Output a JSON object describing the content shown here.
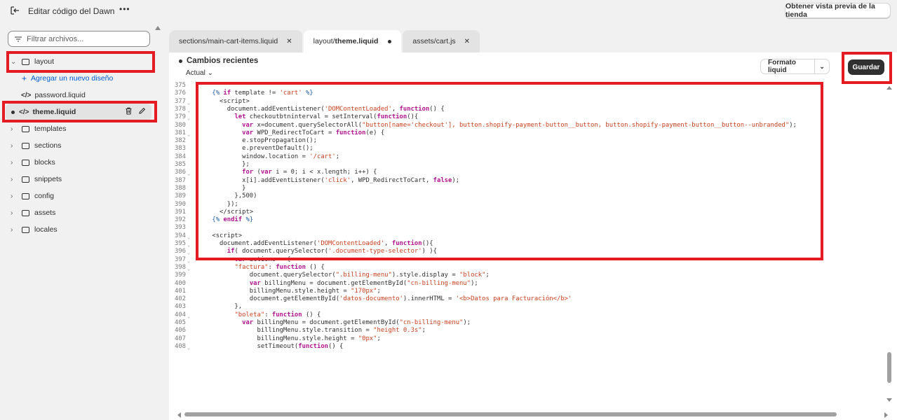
{
  "header": {
    "title": "Editar código del Dawn",
    "more": "•••",
    "preview_label": "Obtener vista previa de la tienda"
  },
  "sidebar": {
    "filter_placeholder": "Filtrar archivos...",
    "items": [
      {
        "type": "folder",
        "label": "layout",
        "expanded": true
      },
      {
        "type": "add",
        "label": "Agregar un nuevo diseño"
      },
      {
        "type": "file",
        "label": "password.liquid"
      },
      {
        "type": "file",
        "label": "theme.liquid",
        "active": true
      },
      {
        "type": "folder",
        "label": "templates"
      },
      {
        "type": "folder",
        "label": "sections"
      },
      {
        "type": "folder",
        "label": "blocks"
      },
      {
        "type": "folder",
        "label": "snippets"
      },
      {
        "type": "folder",
        "label": "config"
      },
      {
        "type": "folder",
        "label": "assets"
      },
      {
        "type": "folder",
        "label": "locales"
      }
    ]
  },
  "tabs": [
    {
      "prefix": "sections/",
      "name": "main-cart-items.liquid",
      "active": false
    },
    {
      "prefix": "layout/",
      "name": "theme.liquid",
      "active": true
    },
    {
      "prefix": "assets/",
      "name": "cart.js",
      "active": false
    }
  ],
  "toolbar": {
    "recent_label": "Cambios recientes",
    "version_label": "Actual",
    "format_label": "Formato liquid",
    "save_label": "Guardar"
  },
  "colors": {
    "highlight": "#e41b23",
    "link": "#005bd3",
    "keyword": "#b2128f",
    "string": "#c93f1e"
  },
  "code_lines": [
    {
      "n": "375",
      "fold": false,
      "html": ""
    },
    {
      "n": "376",
      "fold": false,
      "html": "    <span class=\"fn\">{%</span> <span class=\"kw\">if</span> template != <span class=\"str\">'cart'</span> <span class=\"fn\">%}</span>"
    },
    {
      "n": "377",
      "fold": true,
      "html": "      &lt;script&gt;"
    },
    {
      "n": "378",
      "fold": true,
      "html": "        document.addEventListener(<span class=\"str\">'DOMContentLoaded'</span>, <span class=\"kw\">function</span>() {"
    },
    {
      "n": "379",
      "fold": true,
      "html": "          <span class=\"kw\">let</span> checkoutbtninterval = setInterval(<span class=\"kw\">function</span>(){"
    },
    {
      "n": "380",
      "fold": false,
      "html": "            <span class=\"kw\">var</span> x=document.querySelectorAll(<span class=\"str\">\"button[name='checkout'], button.shopify-payment-button__button, button.shopify-payment-button__button--unbranded\"</span>);"
    },
    {
      "n": "381",
      "fold": true,
      "html": "            <span class=\"kw\">var</span> WPD_RedirectToCart = <span class=\"kw\">function</span>(e) {"
    },
    {
      "n": "382",
      "fold": false,
      "html": "            e.stopPropagation();"
    },
    {
      "n": "383",
      "fold": false,
      "html": "            e.preventDefault();"
    },
    {
      "n": "384",
      "fold": false,
      "html": "            window.location = <span class=\"str\">'/cart'</span>;"
    },
    {
      "n": "385",
      "fold": false,
      "html": "            };"
    },
    {
      "n": "386",
      "fold": true,
      "html": "            <span class=\"kw\">for</span> (<span class=\"kw\">var</span> i = 0; i &lt; x.length; i++) {"
    },
    {
      "n": "387",
      "fold": false,
      "html": "            x[i].addEventListener(<span class=\"str\">'click'</span>, WPD_RedirectToCart, <span class=\"kw\">false</span>);"
    },
    {
      "n": "388",
      "fold": false,
      "html": "            }"
    },
    {
      "n": "389",
      "fold": false,
      "html": "          },500)"
    },
    {
      "n": "390",
      "fold": false,
      "html": "        });"
    },
    {
      "n": "391",
      "fold": false,
      "html": "      &lt;/script&gt;"
    },
    {
      "n": "392",
      "fold": false,
      "html": "    <span class=\"fn\">{%</span> <span class=\"kw\">endif</span> <span class=\"fn\">%}</span>"
    },
    {
      "n": "393",
      "fold": false,
      "html": ""
    },
    {
      "n": "394",
      "fold": true,
      "html": "    &lt;script&gt;"
    },
    {
      "n": "395",
      "fold": true,
      "html": "      document.addEventListener(<span class=\"str\">'DOMContentLoaded'</span>, <span class=\"kw\">function</span>(){"
    },
    {
      "n": "396",
      "fold": true,
      "html": "        <span class=\"kw\">if</span>( document.querySelector(<span class=\"str\">'.document-type-selector'</span>) ){"
    },
    {
      "n": "397",
      "fold": true,
      "html": "          <span class=\"kw\">var</span> actions = {"
    },
    {
      "n": "398",
      "fold": true,
      "html": "          <span class=\"str\">\"factura\"</span>: <span class=\"kw\">function</span> () {"
    },
    {
      "n": "399",
      "fold": false,
      "html": "              document.querySelector(<span class=\"str\">\".billing-menu\"</span>).style.display = <span class=\"str\">\"block\"</span>;"
    },
    {
      "n": "400",
      "fold": false,
      "html": "              <span class=\"kw\">var</span> billingMenu = document.getElementById(<span class=\"str\">\"cn-billing-menu\"</span>);"
    },
    {
      "n": "401",
      "fold": false,
      "html": "              billingMenu.style.height = <span class=\"str\">\"170px\"</span>;"
    },
    {
      "n": "402",
      "fold": false,
      "html": "              document.getElementById(<span class=\"str\">'datos-documento'</span>).innerHTML = <span class=\"str\">'&lt;b&gt;Datos para Facturación&lt;/b&gt;'</span>"
    },
    {
      "n": "403",
      "fold": false,
      "html": "          },"
    },
    {
      "n": "404",
      "fold": true,
      "html": "          <span class=\"str\">\"boleta\"</span>: <span class=\"kw\">function</span> () {"
    },
    {
      "n": "405",
      "fold": false,
      "html": "            <span class=\"kw\">var</span> billingMenu = document.getElementById(<span class=\"str\">\"cn-billing-menu\"</span>);"
    },
    {
      "n": "406",
      "fold": false,
      "html": "                billingMenu.style.transition = <span class=\"str\">\"height 0.3s\"</span>;"
    },
    {
      "n": "407",
      "fold": false,
      "html": "                billingMenu.style.height = <span class=\"str\">\"0px\"</span>;"
    },
    {
      "n": "408",
      "fold": true,
      "html": "                setTimeout(<span class=\"kw\">function</span>() {"
    }
  ]
}
